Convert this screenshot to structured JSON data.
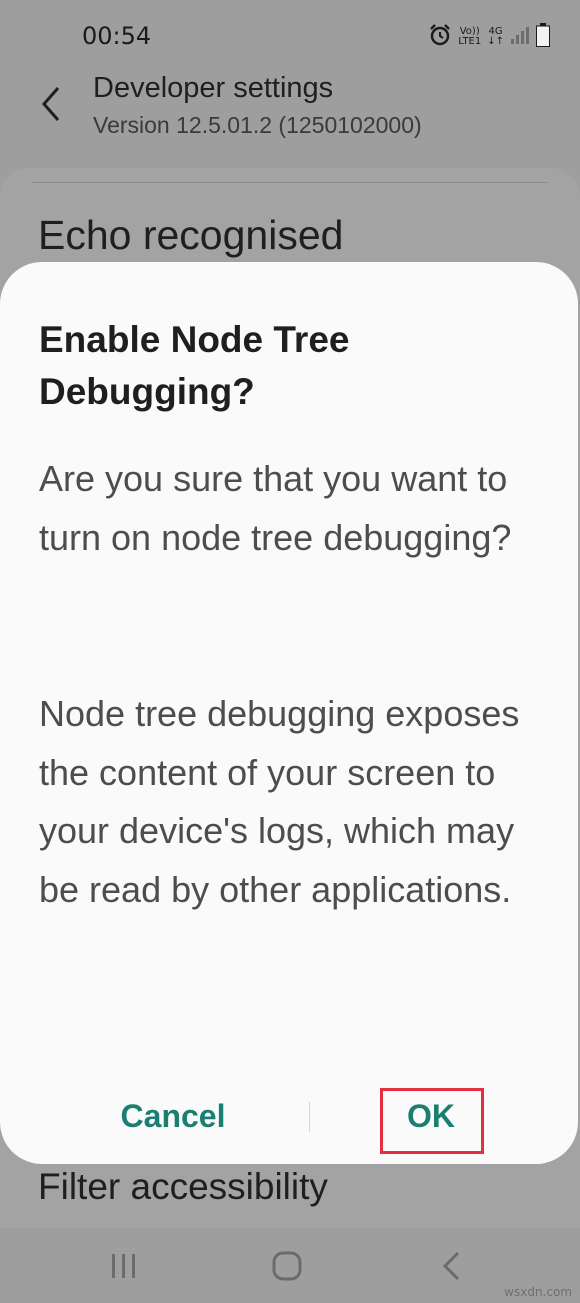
{
  "status_bar": {
    "time": "00:54",
    "volte_label": "Vo))",
    "lte_label": "LTE1",
    "network_label": "4G"
  },
  "header": {
    "title": "Developer settings",
    "subtitle": "Version 12.5.01.2 (1250102000)"
  },
  "background": {
    "heading": "Echo recognised",
    "footer_item": "Filter accessibility"
  },
  "dialog": {
    "title": "Enable Node Tree Debugging?",
    "body_1": "Are you sure that you want to turn on node tree debugging?",
    "body_2": "Node tree debugging exposes the content of your screen to your device's logs, which may be read by other applications.",
    "cancel_label": "Cancel",
    "ok_label": "OK"
  },
  "watermark": "wsxdn.com",
  "colors": {
    "accent": "#1a7f72",
    "highlight": "#e23040",
    "dim_background": "#9e9e9e",
    "dialog_background": "#fafafa"
  },
  "icons": {
    "back": "chevron-left-icon",
    "alarm": "alarm-icon",
    "signal": "signal-icon",
    "battery": "battery-icon",
    "recents": "recents-icon",
    "home": "home-icon",
    "nav_back": "nav-back-icon"
  }
}
